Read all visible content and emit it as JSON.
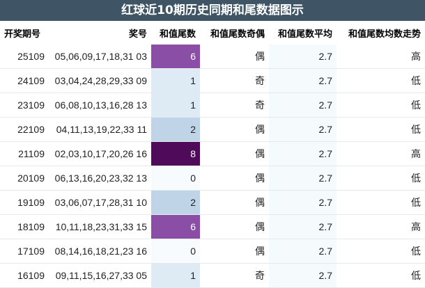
{
  "title": "红球近10期历史同期和尾数据图示",
  "columns": [
    "开奖期号",
    "奖号",
    "和值尾数",
    "和值尾数奇偶",
    "和值尾数平均",
    "和值尾数均数走势"
  ],
  "colors": {
    "header_bg": "#3f5566",
    "tail_scale": {
      "0": "#f7fbfd",
      "1": "#deebf5",
      "2": "#bfd4e7",
      "6": "#8a4ea6",
      "8": "#4f0a59"
    }
  },
  "rows": [
    {
      "period": "25109",
      "numbers": "05,06,09,17,18,31 03",
      "tail": "6",
      "parity": "偶",
      "avg": "2.7",
      "trend": "高"
    },
    {
      "period": "24109",
      "numbers": "03,04,24,28,29,33 09",
      "tail": "1",
      "parity": "奇",
      "avg": "2.7",
      "trend": "低"
    },
    {
      "period": "23109",
      "numbers": "06,08,10,13,16,28 13",
      "tail": "1",
      "parity": "奇",
      "avg": "2.7",
      "trend": "低"
    },
    {
      "period": "22109",
      "numbers": "04,11,13,19,22,33 11",
      "tail": "2",
      "parity": "偶",
      "avg": "2.7",
      "trend": "低"
    },
    {
      "period": "21109",
      "numbers": "02,03,10,17,20,26 16",
      "tail": "8",
      "parity": "偶",
      "avg": "2.7",
      "trend": "高"
    },
    {
      "period": "20109",
      "numbers": "06,13,16,20,23,32 13",
      "tail": "0",
      "parity": "偶",
      "avg": "2.7",
      "trend": "低"
    },
    {
      "period": "19109",
      "numbers": "03,06,07,17,28,31 10",
      "tail": "2",
      "parity": "偶",
      "avg": "2.7",
      "trend": "低"
    },
    {
      "period": "18109",
      "numbers": "10,11,18,23,31,33 15",
      "tail": "6",
      "parity": "偶",
      "avg": "2.7",
      "trend": "高"
    },
    {
      "period": "17109",
      "numbers": "08,14,16,18,21,23 16",
      "tail": "0",
      "parity": "偶",
      "avg": "2.7",
      "trend": "低"
    },
    {
      "period": "16109",
      "numbers": "09,11,15,16,27,33 05",
      "tail": "1",
      "parity": "奇",
      "avg": "2.7",
      "trend": "低"
    }
  ]
}
